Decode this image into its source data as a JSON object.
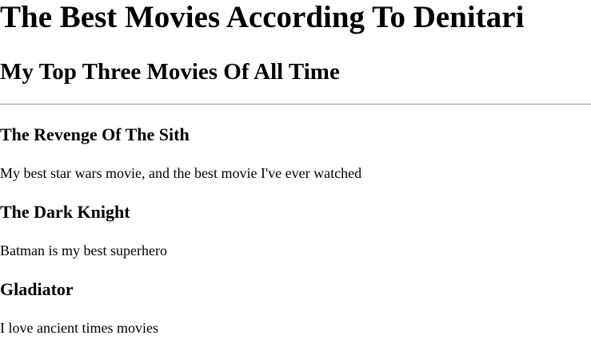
{
  "page": {
    "title": "The Best Movies According To Denitari",
    "subtitle": "My Top Three Movies Of All Time"
  },
  "movies": [
    {
      "title": "The Revenge Of The Sith",
      "description": "My best star wars movie, and the best movie I've ever watched"
    },
    {
      "title": "The Dark Knight",
      "description": "Batman is my best superhero"
    },
    {
      "title": "Gladiator",
      "description": "I love ancient times movies"
    }
  ],
  "colors": {
    "background": "#ffffff",
    "text": "#000000",
    "divider": "#9a9a9a"
  }
}
